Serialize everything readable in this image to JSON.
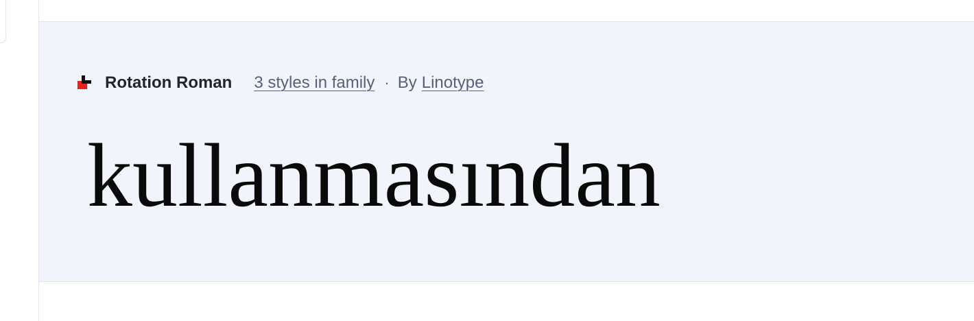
{
  "font_card": {
    "font_name": "Rotation Roman",
    "styles_link": "3 styles in family",
    "separator": "·",
    "by_label": "By",
    "foundry_link": "Linotype",
    "foundry_logo_icon": "linotype-logo-icon",
    "sample_text": "kullanmasından"
  },
  "colors": {
    "card_background": "#f1f4fb",
    "font_name": "#22252b",
    "meta_text": "#58607a",
    "logo_red": "#e8231c",
    "logo_black": "#111111",
    "sample_text": "#0a0a0a"
  }
}
